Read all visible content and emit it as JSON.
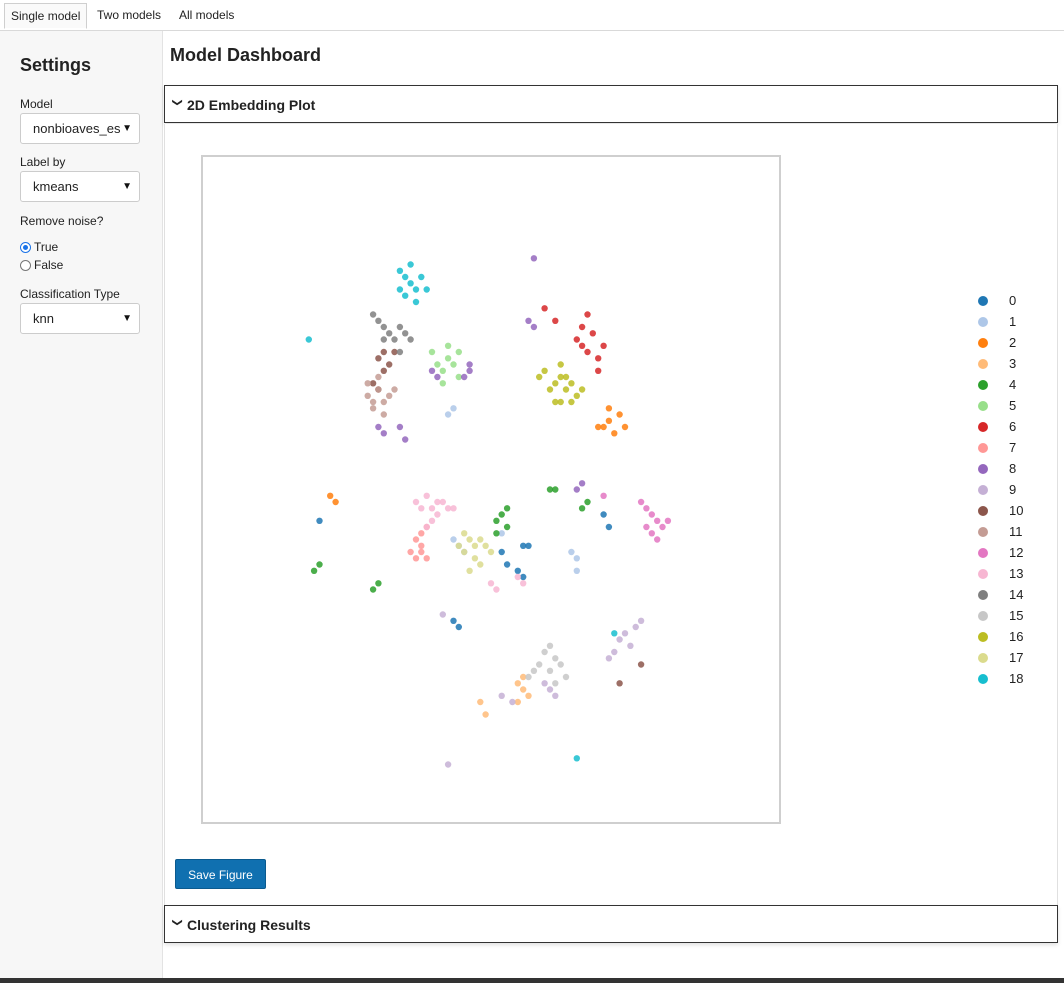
{
  "tabs": [
    {
      "label": "Single model",
      "active": true
    },
    {
      "label": "Two models",
      "active": false
    },
    {
      "label": "All models",
      "active": false
    }
  ],
  "sidebar": {
    "title": "Settings",
    "model_label": "Model",
    "model_value": "nonbioaves_es",
    "label_by_label": "Label by",
    "label_by_value": "kmeans",
    "remove_noise_label": "Remove noise?",
    "remove_noise_options": [
      {
        "label": "True",
        "selected": true
      },
      {
        "label": "False",
        "selected": false
      }
    ],
    "classification_label": "Classification Type",
    "classification_value": "knn"
  },
  "main": {
    "title": "Model Dashboard",
    "panel1_title": "2D Embedding Plot",
    "save_button": "Save Figure",
    "panel2_title": "Clustering Results"
  },
  "icons": {
    "collapse": "chevron-down-icon",
    "dropdown": "caret-down-icon"
  },
  "colors": {
    "accent": "#1070b0",
    "clusters": [
      "#1f77b4",
      "#aec7e8",
      "#ff7f0e",
      "#ffbb78",
      "#2ca02c",
      "#98df8a",
      "#d62728",
      "#ff9896",
      "#9467bd",
      "#c5b0d5",
      "#8c564b",
      "#c49c94",
      "#e377c2",
      "#f7b6d2",
      "#7f7f7f",
      "#c7c7c7",
      "#bcbd22",
      "#dbdb8d",
      "#17becf"
    ]
  },
  "chart_data": {
    "type": "scatter",
    "title": "",
    "legend": [
      "0",
      "1",
      "2",
      "3",
      "4",
      "5",
      "6",
      "7",
      "8",
      "9",
      "10",
      "11",
      "12",
      "13",
      "14",
      "15",
      "16",
      "17",
      "18"
    ],
    "legend_placement": "right",
    "grid": false,
    "axes_visible": false,
    "xlim": [
      0,
      100
    ],
    "ylim": [
      0,
      100
    ],
    "series": [
      {
        "name": "0",
        "points": [
          [
            52,
            40
          ],
          [
            53,
            38
          ],
          [
            55,
            37
          ],
          [
            56,
            36
          ],
          [
            43,
            29
          ],
          [
            44,
            28
          ],
          [
            71,
            46
          ],
          [
            72,
            44
          ],
          [
            18,
            45
          ],
          [
            56,
            41
          ],
          [
            57,
            41
          ]
        ]
      },
      {
        "name": "1",
        "points": [
          [
            43,
            42
          ],
          [
            44,
            41
          ],
          [
            45,
            40
          ],
          [
            65,
            40
          ],
          [
            66,
            39
          ],
          [
            66,
            37
          ],
          [
            42,
            62
          ],
          [
            43,
            63
          ],
          [
            52,
            43
          ]
        ]
      },
      {
        "name": "2",
        "points": [
          [
            71,
            60
          ],
          [
            72,
            61
          ],
          [
            73,
            59
          ],
          [
            74,
            62
          ],
          [
            70,
            60
          ],
          [
            75,
            60
          ],
          [
            72,
            63
          ],
          [
            20,
            49
          ],
          [
            21,
            48
          ]
        ]
      },
      {
        "name": "3",
        "points": [
          [
            55,
            19
          ],
          [
            56,
            20
          ],
          [
            56,
            18
          ],
          [
            57,
            17
          ],
          [
            48,
            16
          ],
          [
            49,
            14
          ],
          [
            55,
            16
          ]
        ]
      },
      {
        "name": "4",
        "points": [
          [
            51,
            45
          ],
          [
            52,
            46
          ],
          [
            53,
            44
          ],
          [
            51,
            43
          ],
          [
            53,
            47
          ],
          [
            61,
            50
          ],
          [
            62,
            50
          ],
          [
            67,
            47
          ],
          [
            68,
            48
          ],
          [
            17,
            37
          ],
          [
            18,
            38
          ],
          [
            28,
            34
          ],
          [
            29,
            35
          ]
        ]
      },
      {
        "name": "5",
        "points": [
          [
            40,
            70
          ],
          [
            41,
            69
          ],
          [
            42,
            71
          ],
          [
            43,
            70
          ],
          [
            44,
            68
          ],
          [
            41,
            67
          ],
          [
            42,
            73
          ],
          [
            39,
            72
          ],
          [
            44,
            72
          ]
        ]
      },
      {
        "name": "6",
        "points": [
          [
            66,
            74
          ],
          [
            67,
            73
          ],
          [
            68,
            72
          ],
          [
            69,
            75
          ],
          [
            70,
            71
          ],
          [
            71,
            73
          ],
          [
            67,
            76
          ],
          [
            68,
            78
          ],
          [
            70,
            69
          ],
          [
            62,
            77
          ],
          [
            60,
            79
          ]
        ]
      },
      {
        "name": "7",
        "points": [
          [
            36,
            42
          ],
          [
            37,
            41
          ],
          [
            37,
            40
          ],
          [
            38,
            39
          ],
          [
            36,
            39
          ],
          [
            37,
            43
          ],
          [
            38,
            44
          ],
          [
            35,
            40
          ]
        ]
      },
      {
        "name": "8",
        "points": [
          [
            39,
            69
          ],
          [
            40,
            68
          ],
          [
            45,
            68
          ],
          [
            46,
            70
          ],
          [
            33,
            60
          ],
          [
            34,
            58
          ],
          [
            29,
            60
          ],
          [
            30,
            59
          ],
          [
            58,
            87
          ],
          [
            58,
            76
          ],
          [
            57,
            77
          ],
          [
            67,
            51
          ],
          [
            66,
            50
          ],
          [
            46,
            69
          ]
        ]
      },
      {
        "name": "9",
        "points": [
          [
            74,
            26
          ],
          [
            75,
            27
          ],
          [
            76,
            25
          ],
          [
            73,
            24
          ],
          [
            77,
            28
          ],
          [
            72,
            23
          ],
          [
            78,
            29
          ],
          [
            60,
            19
          ],
          [
            61,
            18
          ],
          [
            62,
            17
          ],
          [
            52,
            17
          ],
          [
            54,
            16
          ],
          [
            41,
            30
          ],
          [
            42,
            6
          ]
        ]
      },
      {
        "name": "10",
        "points": [
          [
            29,
            71
          ],
          [
            30,
            72
          ],
          [
            31,
            70
          ],
          [
            32,
            72
          ],
          [
            30,
            69
          ],
          [
            29,
            66
          ],
          [
            28,
            67
          ],
          [
            78,
            22
          ],
          [
            74,
            19
          ]
        ]
      },
      {
        "name": "11",
        "points": [
          [
            27,
            65
          ],
          [
            28,
            64
          ],
          [
            29,
            66
          ],
          [
            30,
            64
          ],
          [
            31,
            65
          ],
          [
            28,
            63
          ],
          [
            32,
            66
          ],
          [
            30,
            62
          ],
          [
            27,
            67
          ],
          [
            29,
            68
          ]
        ]
      },
      {
        "name": "12",
        "points": [
          [
            79,
            47
          ],
          [
            80,
            46
          ],
          [
            81,
            45
          ],
          [
            79,
            44
          ],
          [
            80,
            43
          ],
          [
            81,
            42
          ],
          [
            78,
            48
          ],
          [
            82,
            44
          ],
          [
            83,
            45
          ],
          [
            71,
            49
          ]
        ]
      },
      {
        "name": "13",
        "points": [
          [
            36,
            48
          ],
          [
            37,
            47
          ],
          [
            38,
            49
          ],
          [
            39,
            47
          ],
          [
            40,
            46
          ],
          [
            41,
            48
          ],
          [
            42,
            47
          ],
          [
            43,
            47
          ],
          [
            39,
            45
          ],
          [
            38,
            44
          ],
          [
            40,
            48
          ],
          [
            55,
            36
          ],
          [
            56,
            35
          ],
          [
            50,
            35
          ],
          [
            51,
            34
          ]
        ]
      },
      {
        "name": "14",
        "points": [
          [
            29,
            77
          ],
          [
            30,
            76
          ],
          [
            31,
            75
          ],
          [
            32,
            74
          ],
          [
            33,
            76
          ],
          [
            34,
            75
          ],
          [
            35,
            74
          ],
          [
            30,
            74
          ],
          [
            28,
            78
          ],
          [
            33,
            72
          ]
        ]
      },
      {
        "name": "15",
        "points": [
          [
            60,
            24
          ],
          [
            61,
            25
          ],
          [
            62,
            23
          ],
          [
            59,
            22
          ],
          [
            63,
            22
          ],
          [
            58,
            21
          ],
          [
            61,
            21
          ],
          [
            64,
            20
          ],
          [
            57,
            20
          ],
          [
            62,
            19
          ]
        ]
      },
      {
        "name": "16",
        "points": [
          [
            61,
            66
          ],
          [
            62,
            67
          ],
          [
            63,
            68
          ],
          [
            64,
            66
          ],
          [
            65,
            67
          ],
          [
            63,
            64
          ],
          [
            62,
            64
          ],
          [
            66,
            65
          ],
          [
            64,
            68
          ],
          [
            65,
            64
          ],
          [
            67,
            66
          ],
          [
            63,
            70
          ],
          [
            60,
            69
          ],
          [
            59,
            68
          ]
        ]
      },
      {
        "name": "17",
        "points": [
          [
            45,
            43
          ],
          [
            46,
            42
          ],
          [
            47,
            41
          ],
          [
            48,
            42
          ],
          [
            45,
            40
          ],
          [
            44,
            41
          ],
          [
            47,
            39
          ],
          [
            49,
            41
          ],
          [
            46,
            37
          ],
          [
            48,
            38
          ],
          [
            50,
            40
          ]
        ]
      },
      {
        "name": "18",
        "points": [
          [
            33,
            85
          ],
          [
            34,
            84
          ],
          [
            35,
            83
          ],
          [
            36,
            82
          ],
          [
            34,
            81
          ],
          [
            35,
            86
          ],
          [
            37,
            84
          ],
          [
            36,
            80
          ],
          [
            38,
            82
          ],
          [
            33,
            82
          ],
          [
            16,
            74
          ],
          [
            66,
            7
          ],
          [
            73,
            27
          ]
        ]
      }
    ]
  }
}
